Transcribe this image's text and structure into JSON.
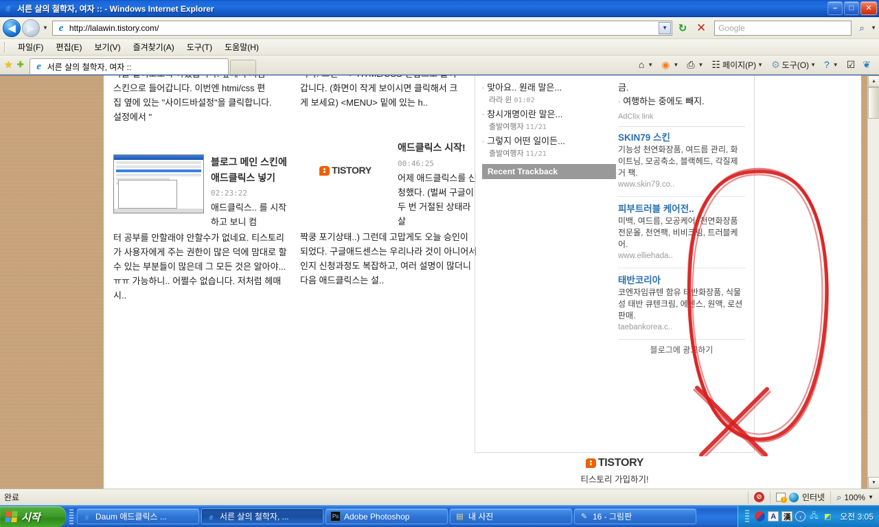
{
  "window": {
    "title": "서른 살의 철학자, 여자 :: - Windows Internet Explorer",
    "minimize_label": "–",
    "maximize_label": "□",
    "close_label": "✕"
  },
  "navbar": {
    "back_label": "◀",
    "forward_label": "▶",
    "dropdown_label": "▼",
    "url": "http://lalawin.tistory.com/",
    "url_dropdown_label": "▼",
    "refresh_label": "↻",
    "stop_label": "✕",
    "search_placeholder": "Google",
    "search_value": "",
    "search_go_label": "⌕",
    "search_dropdown_label": "▼"
  },
  "menubar": {
    "items": [
      {
        "label": "파일(F)"
      },
      {
        "label": "편집(E)"
      },
      {
        "label": "보기(V)"
      },
      {
        "label": "즐겨찾기(A)"
      },
      {
        "label": "도구(T)"
      },
      {
        "label": "도움말(H)"
      }
    ]
  },
  "tabbar": {
    "favorites_label": "★",
    "add_favorite_label": "✚",
    "tab_title": "서른 살의 철학자, 여자 ::",
    "new_tab_label": "",
    "tools": [
      {
        "name": "home",
        "glyph": "⌂",
        "label": "",
        "caret": "▼"
      },
      {
        "name": "feeds",
        "glyph": "◉",
        "label": "",
        "caret": "▼"
      },
      {
        "name": "print",
        "glyph": "⎙",
        "label": "",
        "caret": "▼"
      },
      {
        "name": "page",
        "glyph": "☷",
        "label": "페이지(P)",
        "caret": "▼"
      },
      {
        "name": "tools",
        "glyph": "⚙",
        "label": "도구(O)",
        "caret": "▼"
      },
      {
        "name": "help",
        "glyph": "?",
        "label": "",
        "caret": "▼"
      },
      {
        "name": "research",
        "glyph": "☑",
        "label": "",
        "caret": ""
      },
      {
        "name": "messenger",
        "glyph": "❦",
        "label": "",
        "caret": ""
      }
    ]
  },
  "page": {
    "clipped_top_left": "마를 덜어보도록 하겠습니다. 앞에서 처럼",
    "clipped_top_right": "니다. 그런 ---> HTML/CSS 편집으로 들어",
    "left_column_intro": [
      "스킨으로 들어갑니다. 이번엔 htmi/css 편",
      "집 옆에 있는 \"사이드바설정\"을 클릭합니다.",
      "설정에서 \""
    ],
    "right_column_intro": [
      "갑니다. (화면이 작게 보이시면 클릭해서 크",
      "게 보세요) <MENU> 밑에 있는 h.."
    ],
    "posts": [
      {
        "title": "블로그 메인 스킨에 애드클릭스 넣기",
        "time": "02:23:22",
        "body_head": "애드클릭스.. 를 시작하고 보니 컴",
        "body_rest": "터 공부를 안할래야 안할수가 없네요. 티스토리가 사용자에게 주는 권한이 많은 덕에 맘대로 할 수 있는 부분들이 많은데 그 모든 것은 알아야...ㅠㅠ 가능하니.. 어쩔수 없습니다. 저처럼 헤매시.."
      },
      {
        "title": "애드클릭스 시작!",
        "time": "00:46:25",
        "body_head": "어제 애드클릭스를 신청했다. (벌써 구글이 두 번 거절된 상태라 살",
        "body_rest": "짝쿵 포기상태..) 그런데 고맙게도 오늘 승인이 되었다. 구글애드센스는 우리나라 것이 아니어서인지 신청과정도 복잡하고, 여러 설명이 많더니 다음 애드클릭스는 설..",
        "logo_text": "TISTORY"
      }
    ]
  },
  "sidebar": {
    "recent_comments": [
      {
        "text": "맞아요.. 원래 말은...",
        "author": "라라 윈",
        "time": "01:02"
      },
      {
        "text": "창시개명이란 말은...",
        "author": "출발여행자",
        "time": "11/21"
      },
      {
        "text": "그렇지 어떤 일이든...",
        "author": "출발여행자",
        "time": "11/21"
      }
    ],
    "section_title": "Recent Trackback",
    "clipped_right_a": "금.",
    "clipped_right_b": "여행하는 중에도 빼지."
  },
  "ads": {
    "label": "AdClix link",
    "items": [
      {
        "title": "SKIN79 스킨",
        "desc": "기능성 천연화장품, 여드름 관리, 화이트닝, 모공축소, 블랙헤드, 각질제거 팩.",
        "url": "www.skin79.co.."
      },
      {
        "title": "피부트러블 케어전..",
        "desc": "미백, 여드름, 모공케어, 천연화장품 전문몰, 천연팩, 비비크림, 트러블케어.",
        "url": "www.elliehada.."
      },
      {
        "title": "태반코리아",
        "desc": "코엔자임큐텐 함유 태반화장품, 식물성 태반 큐텐크림, 에센스, 원액, 로션판매.",
        "url": "taebankorea.c.."
      }
    ],
    "cta": "블로그에 광고하기"
  },
  "footer": {
    "logo_text": "TISTORY",
    "signup_text": "티스토리 가입하기!"
  },
  "statusbar": {
    "status_text": "완료",
    "zone_text": "인터넷",
    "zoom_text": "100%",
    "zoom_dropdown": "▼",
    "zoom_icon": "⌕"
  },
  "taskbar": {
    "start_label": "시작",
    "items": [
      {
        "label": "Daum 애드클릭스 ...",
        "icon": "ie-icon",
        "active": false
      },
      {
        "label": "서른 살의 철학자, ...",
        "icon": "ie-icon",
        "active": true
      },
      {
        "label": "Adobe Photoshop",
        "icon": "photoshop-icon",
        "active": false
      },
      {
        "label": "내 사진",
        "icon": "folder-icon",
        "active": false
      },
      {
        "label": "16 - 그림판",
        "icon": "paint-icon",
        "active": false
      }
    ],
    "tray": {
      "ime_alpha": "A",
      "ime_han": "漢",
      "clock": "오전 3:05"
    }
  },
  "colors": {
    "accent_blue": "#1e6fe0",
    "start_green": "#3f9c28",
    "annotation_red": "#d81f1f",
    "ad_title_blue": "#2a6fb0",
    "tistory_orange": "#f06000",
    "page_background": "#c79f73"
  }
}
